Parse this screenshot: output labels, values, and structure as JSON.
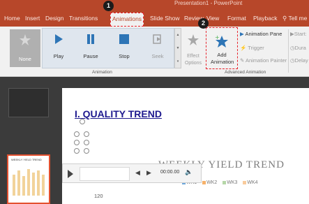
{
  "window": {
    "title": "Presentation1 - PowerPoint"
  },
  "tabs": [
    "Home",
    "Insert",
    "Design",
    "Transitions",
    "Animations",
    "Slide Show",
    "Review",
    "View",
    "Format",
    "Playback"
  ],
  "active_tab": "Animations",
  "tell_me": "Tell me",
  "ribbon": {
    "none_label": "None",
    "effects": [
      {
        "label": "Play",
        "icon": "play-icon"
      },
      {
        "label": "Pause",
        "icon": "pause-icon"
      },
      {
        "label": "Stop",
        "icon": "stop-icon"
      },
      {
        "label": "Seek",
        "icon": "seek-icon"
      }
    ],
    "effect_options": "Effect Options",
    "add_animation": "Add Animation",
    "animation_group": "Animation",
    "animation_pane": "Animation Pane",
    "trigger": "Trigger",
    "animation_painter": "Animation Painter",
    "advanced_group": "Advanced Animation",
    "start": "Start:",
    "duration": "Dura",
    "delay": "Delay"
  },
  "callouts": [
    "1",
    "2"
  ],
  "slide": {
    "title": "I. QUALITY TREND",
    "chart_title": "WEEKLY YIELD TREND",
    "legend": [
      "WK1",
      "WK2",
      "WK3",
      "WK4"
    ],
    "y_tick": "120"
  },
  "media": {
    "time": "00:00.00"
  },
  "colors": {
    "accent": "#b7472a",
    "callout_highlight": "#e8222b",
    "title_blue": "#1f1a8f",
    "icon_blue": "#2e75b6",
    "legend": [
      "#6fa8dc",
      "#f6b26b",
      "#b6d7a8",
      "#f9cb9c"
    ]
  }
}
